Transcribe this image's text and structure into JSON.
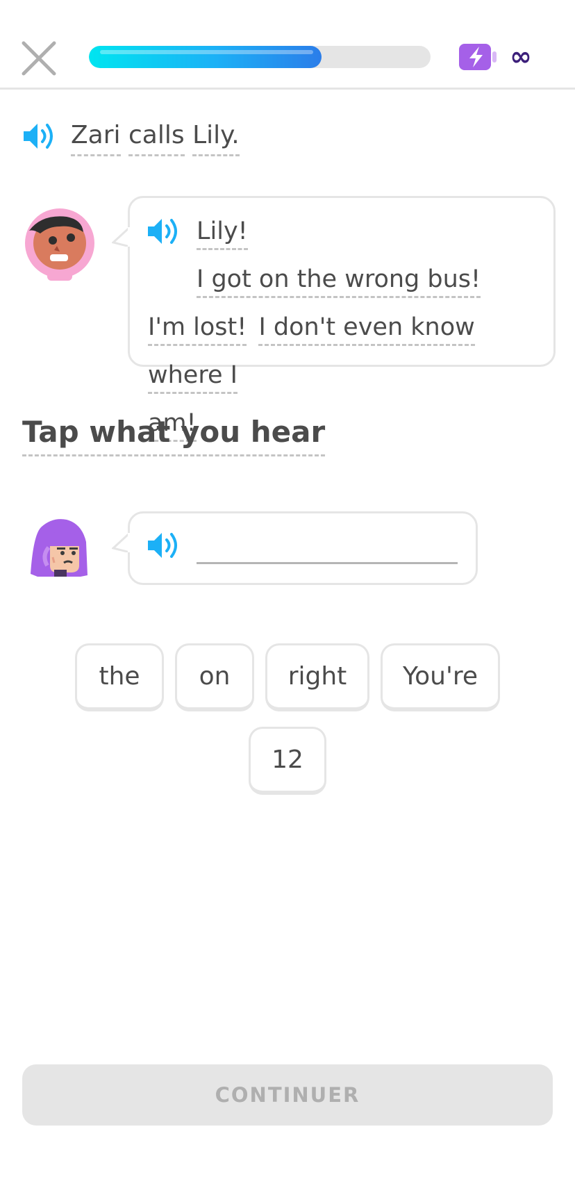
{
  "header": {
    "close_icon": "close-icon",
    "progress_fraction": 0.68,
    "energy_icon": "energy-battery-icon",
    "energy_label": "∞",
    "colors": {
      "progress_start": "#00e5f0",
      "progress_end": "#2b7de9",
      "energy": "#a560e8",
      "infinity": "#3c1f7a"
    }
  },
  "narration": {
    "speaker_icon": "speaker-icon",
    "words": [
      "Zari",
      "calls",
      "Lily."
    ]
  },
  "zari_bubble": {
    "avatar_icon": "zari-avatar",
    "speaker_icon": "speaker-icon",
    "lines": [
      [
        "Lily!",
        "I got on the wrong bus!"
      ],
      [
        "I'm lost!",
        "I don't even know",
        "where I"
      ],
      [
        "am!"
      ]
    ]
  },
  "prompt": {
    "title": "Tap what you hear"
  },
  "lily_bubble": {
    "avatar_icon": "lily-avatar",
    "speaker_icon": "speaker-icon"
  },
  "word_bank": {
    "row1": [
      "the",
      "on",
      "right",
      "You're"
    ],
    "row2": [
      "12"
    ]
  },
  "footer": {
    "continue_label": "CONTINUER"
  },
  "accent_color": "#1cb0f6"
}
